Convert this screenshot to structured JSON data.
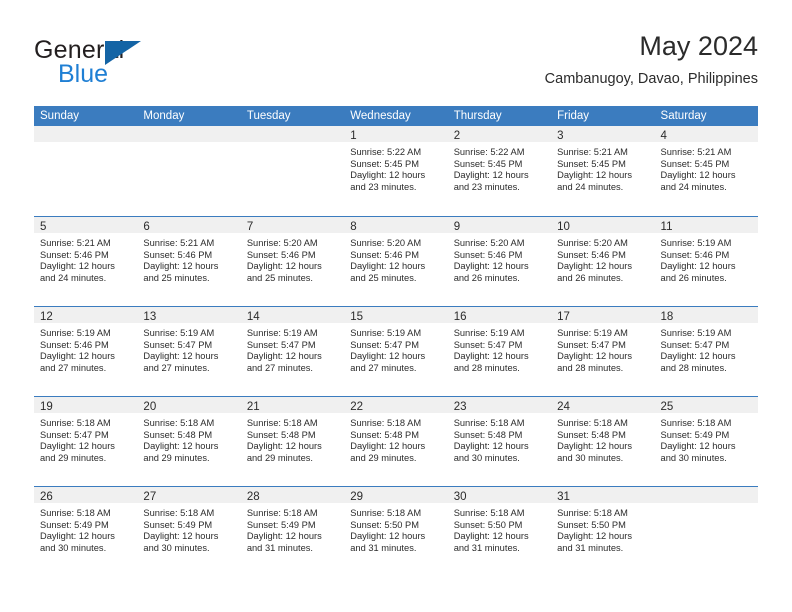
{
  "brand": {
    "word_one": "General",
    "word_two": "Blue",
    "triangle_icon": "triangle-icon",
    "accent_color": "#1f7fd4",
    "triangle_color": "#1464a5"
  },
  "header": {
    "title": "May 2024",
    "subtitle": "Cambanugoy, Davao, Philippines"
  },
  "calendar": {
    "header_color": "#3b7cbf",
    "day_band_color": "#f0f0f0",
    "weekdays": [
      "Sunday",
      "Monday",
      "Tuesday",
      "Wednesday",
      "Thursday",
      "Friday",
      "Saturday"
    ],
    "weeks": [
      [
        {
          "day": "",
          "sunrise": "",
          "sunset": "",
          "daylight": "",
          "empty": true
        },
        {
          "day": "",
          "sunrise": "",
          "sunset": "",
          "daylight": "",
          "empty": true
        },
        {
          "day": "",
          "sunrise": "",
          "sunset": "",
          "daylight": "",
          "empty": true
        },
        {
          "day": "1",
          "sunrise": "Sunrise: 5:22 AM",
          "sunset": "Sunset: 5:45 PM",
          "daylight": "Daylight: 12 hours and 23 minutes.",
          "empty": false
        },
        {
          "day": "2",
          "sunrise": "Sunrise: 5:22 AM",
          "sunset": "Sunset: 5:45 PM",
          "daylight": "Daylight: 12 hours and 23 minutes.",
          "empty": false
        },
        {
          "day": "3",
          "sunrise": "Sunrise: 5:21 AM",
          "sunset": "Sunset: 5:45 PM",
          "daylight": "Daylight: 12 hours and 24 minutes.",
          "empty": false
        },
        {
          "day": "4",
          "sunrise": "Sunrise: 5:21 AM",
          "sunset": "Sunset: 5:45 PM",
          "daylight": "Daylight: 12 hours and 24 minutes.",
          "empty": false
        }
      ],
      [
        {
          "day": "5",
          "sunrise": "Sunrise: 5:21 AM",
          "sunset": "Sunset: 5:46 PM",
          "daylight": "Daylight: 12 hours and 24 minutes.",
          "empty": false
        },
        {
          "day": "6",
          "sunrise": "Sunrise: 5:21 AM",
          "sunset": "Sunset: 5:46 PM",
          "daylight": "Daylight: 12 hours and 25 minutes.",
          "empty": false
        },
        {
          "day": "7",
          "sunrise": "Sunrise: 5:20 AM",
          "sunset": "Sunset: 5:46 PM",
          "daylight": "Daylight: 12 hours and 25 minutes.",
          "empty": false
        },
        {
          "day": "8",
          "sunrise": "Sunrise: 5:20 AM",
          "sunset": "Sunset: 5:46 PM",
          "daylight": "Daylight: 12 hours and 25 minutes.",
          "empty": false
        },
        {
          "day": "9",
          "sunrise": "Sunrise: 5:20 AM",
          "sunset": "Sunset: 5:46 PM",
          "daylight": "Daylight: 12 hours and 26 minutes.",
          "empty": false
        },
        {
          "day": "10",
          "sunrise": "Sunrise: 5:20 AM",
          "sunset": "Sunset: 5:46 PM",
          "daylight": "Daylight: 12 hours and 26 minutes.",
          "empty": false
        },
        {
          "day": "11",
          "sunrise": "Sunrise: 5:19 AM",
          "sunset": "Sunset: 5:46 PM",
          "daylight": "Daylight: 12 hours and 26 minutes.",
          "empty": false
        }
      ],
      [
        {
          "day": "12",
          "sunrise": "Sunrise: 5:19 AM",
          "sunset": "Sunset: 5:46 PM",
          "daylight": "Daylight: 12 hours and 27 minutes.",
          "empty": false
        },
        {
          "day": "13",
          "sunrise": "Sunrise: 5:19 AM",
          "sunset": "Sunset: 5:47 PM",
          "daylight": "Daylight: 12 hours and 27 minutes.",
          "empty": false
        },
        {
          "day": "14",
          "sunrise": "Sunrise: 5:19 AM",
          "sunset": "Sunset: 5:47 PM",
          "daylight": "Daylight: 12 hours and 27 minutes.",
          "empty": false
        },
        {
          "day": "15",
          "sunrise": "Sunrise: 5:19 AM",
          "sunset": "Sunset: 5:47 PM",
          "daylight": "Daylight: 12 hours and 27 minutes.",
          "empty": false
        },
        {
          "day": "16",
          "sunrise": "Sunrise: 5:19 AM",
          "sunset": "Sunset: 5:47 PM",
          "daylight": "Daylight: 12 hours and 28 minutes.",
          "empty": false
        },
        {
          "day": "17",
          "sunrise": "Sunrise: 5:19 AM",
          "sunset": "Sunset: 5:47 PM",
          "daylight": "Daylight: 12 hours and 28 minutes.",
          "empty": false
        },
        {
          "day": "18",
          "sunrise": "Sunrise: 5:19 AM",
          "sunset": "Sunset: 5:47 PM",
          "daylight": "Daylight: 12 hours and 28 minutes.",
          "empty": false
        }
      ],
      [
        {
          "day": "19",
          "sunrise": "Sunrise: 5:18 AM",
          "sunset": "Sunset: 5:47 PM",
          "daylight": "Daylight: 12 hours and 29 minutes.",
          "empty": false
        },
        {
          "day": "20",
          "sunrise": "Sunrise: 5:18 AM",
          "sunset": "Sunset: 5:48 PM",
          "daylight": "Daylight: 12 hours and 29 minutes.",
          "empty": false
        },
        {
          "day": "21",
          "sunrise": "Sunrise: 5:18 AM",
          "sunset": "Sunset: 5:48 PM",
          "daylight": "Daylight: 12 hours and 29 minutes.",
          "empty": false
        },
        {
          "day": "22",
          "sunrise": "Sunrise: 5:18 AM",
          "sunset": "Sunset: 5:48 PM",
          "daylight": "Daylight: 12 hours and 29 minutes.",
          "empty": false
        },
        {
          "day": "23",
          "sunrise": "Sunrise: 5:18 AM",
          "sunset": "Sunset: 5:48 PM",
          "daylight": "Daylight: 12 hours and 30 minutes.",
          "empty": false
        },
        {
          "day": "24",
          "sunrise": "Sunrise: 5:18 AM",
          "sunset": "Sunset: 5:48 PM",
          "daylight": "Daylight: 12 hours and 30 minutes.",
          "empty": false
        },
        {
          "day": "25",
          "sunrise": "Sunrise: 5:18 AM",
          "sunset": "Sunset: 5:49 PM",
          "daylight": "Daylight: 12 hours and 30 minutes.",
          "empty": false
        }
      ],
      [
        {
          "day": "26",
          "sunrise": "Sunrise: 5:18 AM",
          "sunset": "Sunset: 5:49 PM",
          "daylight": "Daylight: 12 hours and 30 minutes.",
          "empty": false
        },
        {
          "day": "27",
          "sunrise": "Sunrise: 5:18 AM",
          "sunset": "Sunset: 5:49 PM",
          "daylight": "Daylight: 12 hours and 30 minutes.",
          "empty": false
        },
        {
          "day": "28",
          "sunrise": "Sunrise: 5:18 AM",
          "sunset": "Sunset: 5:49 PM",
          "daylight": "Daylight: 12 hours and 31 minutes.",
          "empty": false
        },
        {
          "day": "29",
          "sunrise": "Sunrise: 5:18 AM",
          "sunset": "Sunset: 5:50 PM",
          "daylight": "Daylight: 12 hours and 31 minutes.",
          "empty": false
        },
        {
          "day": "30",
          "sunrise": "Sunrise: 5:18 AM",
          "sunset": "Sunset: 5:50 PM",
          "daylight": "Daylight: 12 hours and 31 minutes.",
          "empty": false
        },
        {
          "day": "31",
          "sunrise": "Sunrise: 5:18 AM",
          "sunset": "Sunset: 5:50 PM",
          "daylight": "Daylight: 12 hours and 31 minutes.",
          "empty": false
        },
        {
          "day": "",
          "sunrise": "",
          "sunset": "",
          "daylight": "",
          "empty": true
        }
      ]
    ]
  }
}
